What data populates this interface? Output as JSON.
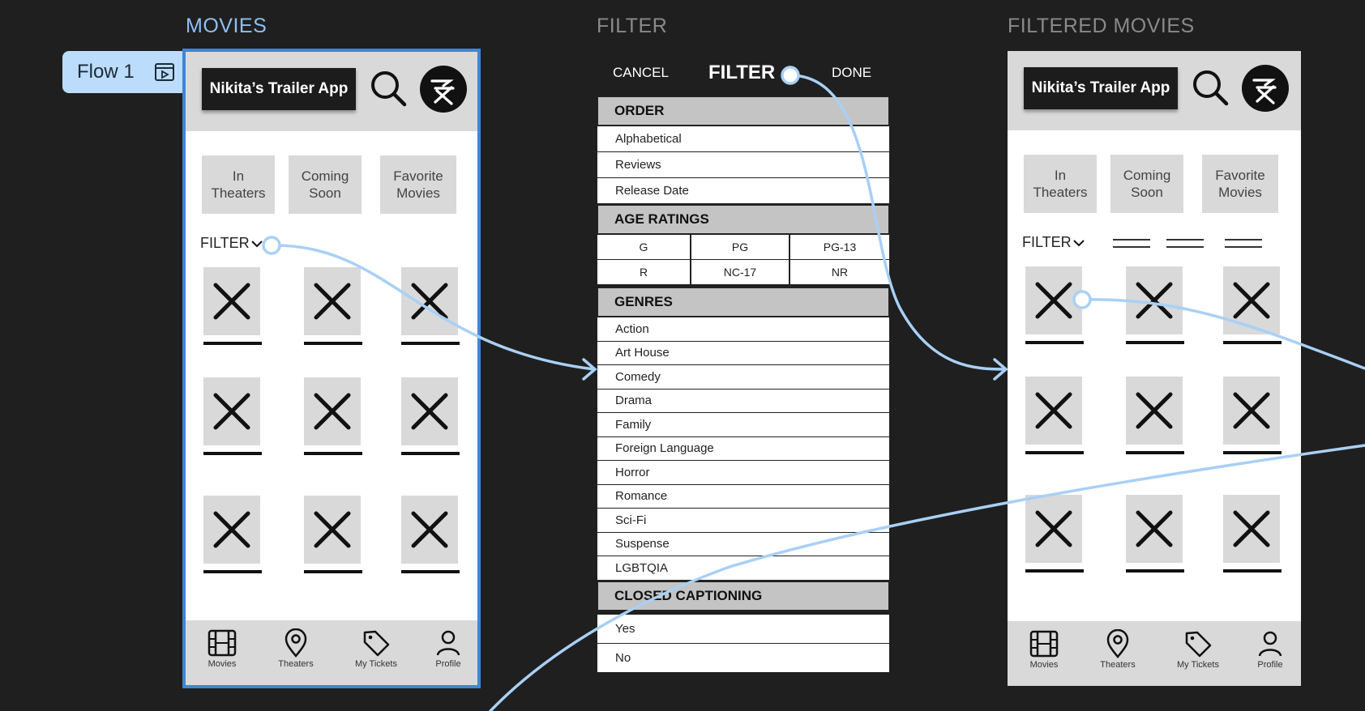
{
  "frames": {
    "movies": {
      "title": "MOVIES"
    },
    "filter": {
      "title": "FILTER"
    },
    "filtered": {
      "title": "FILTERED MOVIES"
    }
  },
  "flow": {
    "label": "Flow 1"
  },
  "app": {
    "title": "Nikita’s Trailer App"
  },
  "categories": [
    "In\nTheaters",
    "Coming\nSoon",
    "Favorite\nMovies"
  ],
  "filter_toggle": {
    "label": "FILTER"
  },
  "nav": [
    "Movies",
    "Theaters",
    "My Tickets",
    "Profile"
  ],
  "icons": {
    "flow": "flow-play-icon",
    "search": "search-icon",
    "logo": "app-logo-icon",
    "poster": "poster-placeholder-icon",
    "chevron": "chevron-down-icon",
    "nav": [
      "film-icon",
      "map-pin-icon",
      "tag-icon",
      "user-icon"
    ]
  },
  "filter_sheet": {
    "cancel": "CANCEL",
    "title": "FILTER",
    "done": "DONE",
    "order": {
      "heading": "ORDER",
      "items": [
        "Alphabetical",
        "Reviews",
        "Release Date"
      ]
    },
    "age": {
      "heading": "AGE RATINGS",
      "items": [
        "G",
        "PG",
        "PG-13",
        "R",
        "NC-17",
        "NR"
      ]
    },
    "genres": {
      "heading": "GENRES",
      "items": [
        "Action",
        "Art House",
        "Comedy",
        "Drama",
        "Family",
        "Foreign Language",
        "Horror",
        "Romance",
        "Sci-Fi",
        "Suspense",
        "LGBTQIA"
      ]
    },
    "cc": {
      "heading": "CLOSED CAPTIONING",
      "items": [
        "Yes",
        "No"
      ]
    }
  },
  "colors": {
    "canvas": "#1f1f1f",
    "connector": "#a9d0f5",
    "selection": "#3d86d6",
    "header_gray": "#d9d9d9",
    "flow_tag": "#bcdcfb"
  }
}
